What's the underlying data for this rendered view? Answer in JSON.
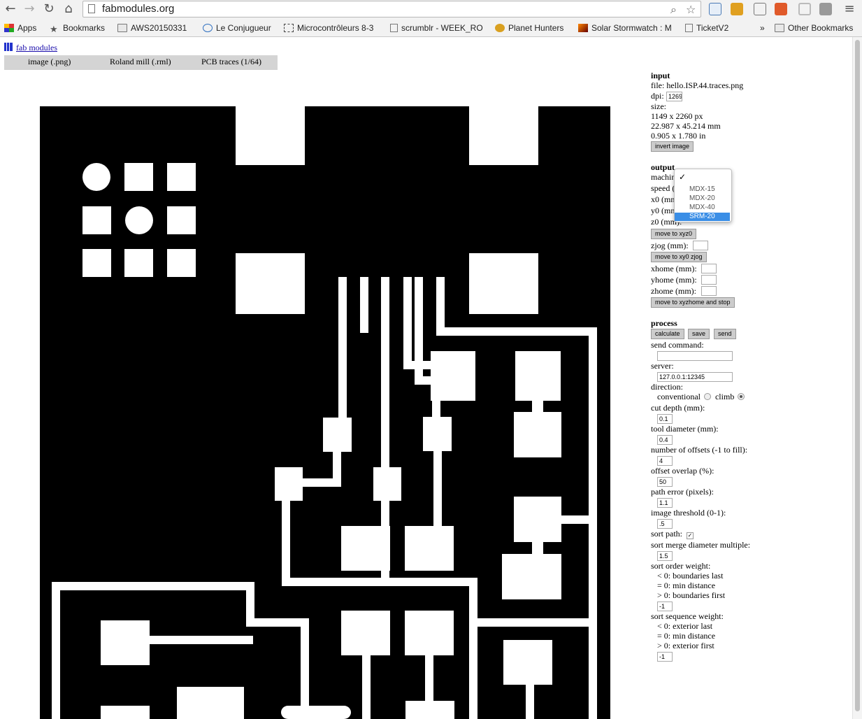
{
  "browser": {
    "url": "fabmodules.org",
    "bookmarks": [
      {
        "label": "Apps",
        "icon": "apps-grid-icon"
      },
      {
        "label": "Bookmarks",
        "icon": "star-icon"
      },
      {
        "label": "AWS20150331",
        "icon": "folder-icon"
      },
      {
        "label": "Le Conjugueur",
        "icon": "conjugueur-icon"
      },
      {
        "label": "Microcontrôleurs 8-3",
        "icon": "chip-icon"
      },
      {
        "label": "scrumblr - WEEK_RO",
        "icon": "page-icon"
      },
      {
        "label": "Planet Hunters",
        "icon": "planet-icon"
      },
      {
        "label": "Solar Stormwatch : M",
        "icon": "solar-icon"
      },
      {
        "label": "TicketV2",
        "icon": "page-icon"
      },
      {
        "label": "»",
        "icon": ""
      },
      {
        "label": "Other Bookmarks",
        "icon": "folder-icon"
      }
    ]
  },
  "site": {
    "link": "fab modules",
    "tabs": [
      "image (.png)",
      "Roland mill (.rml)",
      "PCB traces (1/64)"
    ]
  },
  "input": {
    "heading": "input",
    "file": "file: hello.ISP.44.traces.png",
    "dpi_label": "dpi:",
    "dpi_value": "1269",
    "size_label": "size:",
    "size_px": "1149 x 2260 px",
    "size_mm": "22.987 x 45.214 mm",
    "size_in": "0.905 x 1.780 in",
    "invert_button": "invert image"
  },
  "output": {
    "heading": "output",
    "machine_label": "machin",
    "speed_label": "speed (",
    "x0_label": "x0 (mn",
    "y0_label": "y0 (mn",
    "z0_label": "z0 (mm):",
    "move_xyz0": "move to xyz0",
    "zjog_label": "zjog (mm):",
    "move_xy0_zjog": "move to xy0 zjog",
    "xhome_label": "xhome (mm):",
    "yhome_label": "yhome (mm):",
    "zhome_label": "zhome (mm):",
    "move_home": "move to xyzhome and stop",
    "machine_options": [
      "MDX-15",
      "MDX-20",
      "MDX-40",
      "SRM-20"
    ],
    "machine_selected": "SRM-20"
  },
  "process": {
    "heading": "process",
    "calculate": "calculate",
    "save": "save",
    "send": "send",
    "send_command_label": "send command:",
    "server_label": "server:",
    "server_value": "127.0.0.1:12345",
    "direction_label": "direction:",
    "conventional": "conventional",
    "climb": "climb",
    "direction_selected": "climb",
    "cut_depth_label": "cut depth (mm):",
    "cut_depth": "0.1",
    "tool_diameter_label": "tool diameter (mm):",
    "tool_diameter": "0.4",
    "offsets_label": "number of offsets (-1 to fill):",
    "offsets": "4",
    "overlap_label": "offset overlap (%):",
    "overlap": "50",
    "path_error_label": "path error (pixels):",
    "path_error": "1.1",
    "threshold_label": "image threshold (0-1):",
    "threshold": ".5",
    "sort_path_label": "sort path:",
    "sort_path_checked": true,
    "merge_label": "sort merge diameter multiple:",
    "merge": "1.5",
    "order_label": "sort order weight:",
    "order_lt": "< 0: boundaries last",
    "order_eq": "= 0: min distance",
    "order_gt": "> 0: boundaries first",
    "order_value": "-1",
    "seq_label": "sort sequence weight:",
    "seq_lt": "< 0: exterior last",
    "seq_eq": "= 0: min distance",
    "seq_gt": "> 0: exterior first",
    "seq_value": "-1"
  },
  "colors": {
    "pcb_background": "#000000",
    "pcb_trace": "#ffffff",
    "dropdown_highlight": "#3a8ee6"
  }
}
